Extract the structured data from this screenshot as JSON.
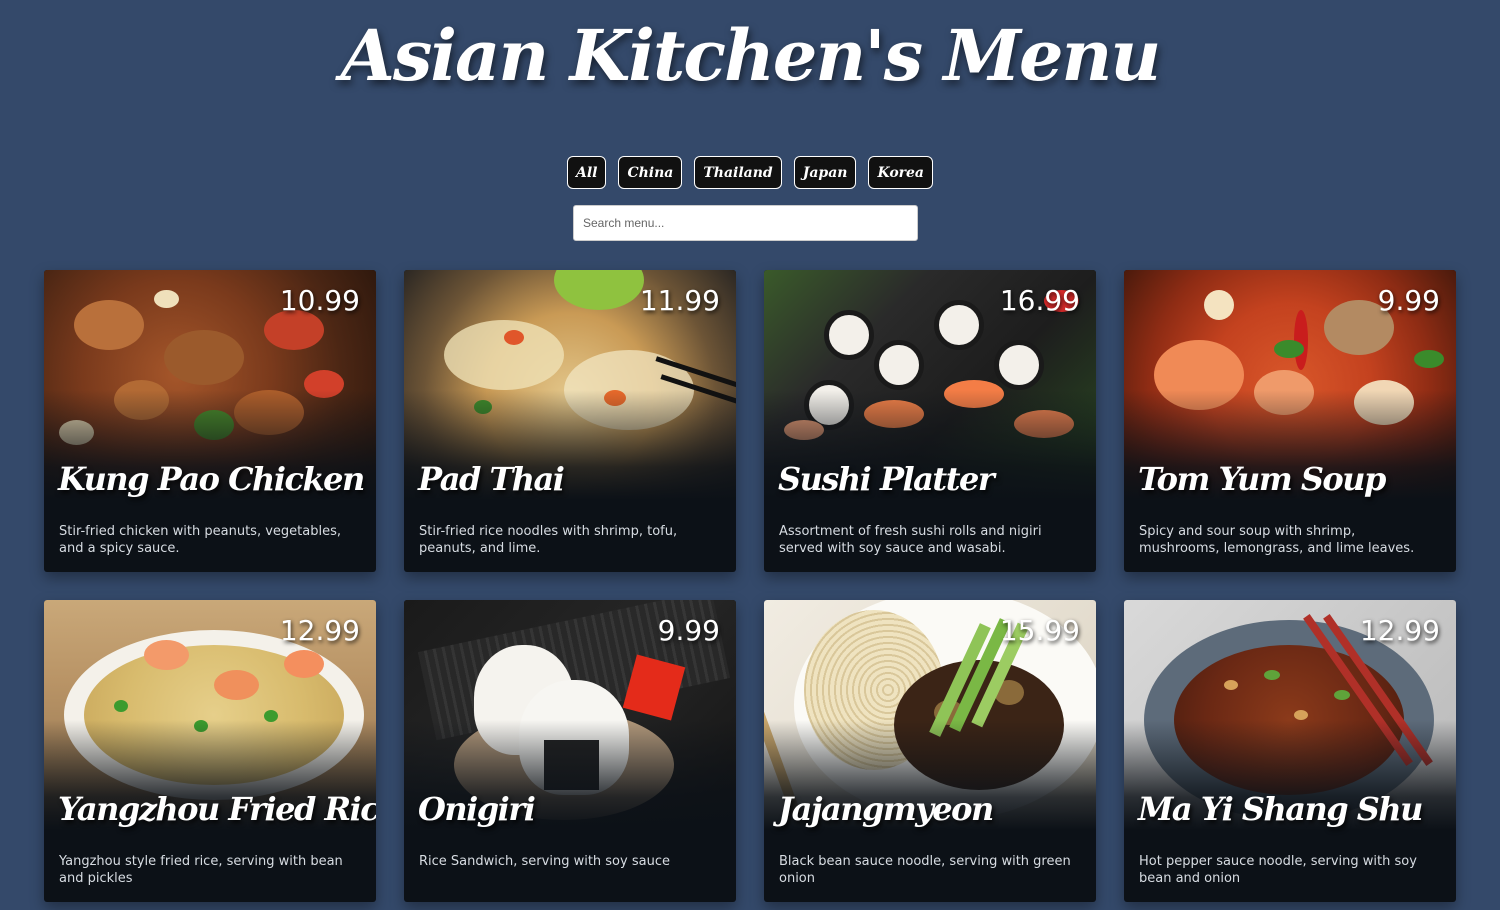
{
  "header": {
    "title": "Asian Kitchen's Menu"
  },
  "filters": [
    "All",
    "China",
    "Thailand",
    "Japan",
    "Korea"
  ],
  "search": {
    "placeholder": "Search menu...",
    "value": ""
  },
  "menu": [
    {
      "name": "Kung Pao Chicken",
      "price": "10.99",
      "description": "Stir-fried chicken with peanuts, vegetables, and a spicy sauce."
    },
    {
      "name": "Pad Thai",
      "price": "11.99",
      "description": "Stir-fried rice noodles with shrimp, tofu, peanuts, and lime."
    },
    {
      "name": "Sushi Platter",
      "price": "16.99",
      "description": "Assortment of fresh sushi rolls and nigiri served with soy sauce and wasabi."
    },
    {
      "name": "Tom Yum Soup",
      "price": "9.99",
      "description": "Spicy and sour soup with shrimp, mushrooms, lemongrass, and lime leaves."
    },
    {
      "name": "Yangzhou Fried Rice",
      "price": "12.99",
      "description": "Yangzhou style fried rice, serving with bean and pickles"
    },
    {
      "name": "Onigiri",
      "price": "9.99",
      "description": "Rice Sandwich, serving with soy sauce"
    },
    {
      "name": "Jajangmyeon",
      "price": "15.99",
      "description": "Black bean sauce noodle, serving with green onion"
    },
    {
      "name": "Ma Yi Shang Shu",
      "price": "12.99",
      "description": "Hot pepper sauce noodle, serving with soy bean and onion"
    }
  ]
}
